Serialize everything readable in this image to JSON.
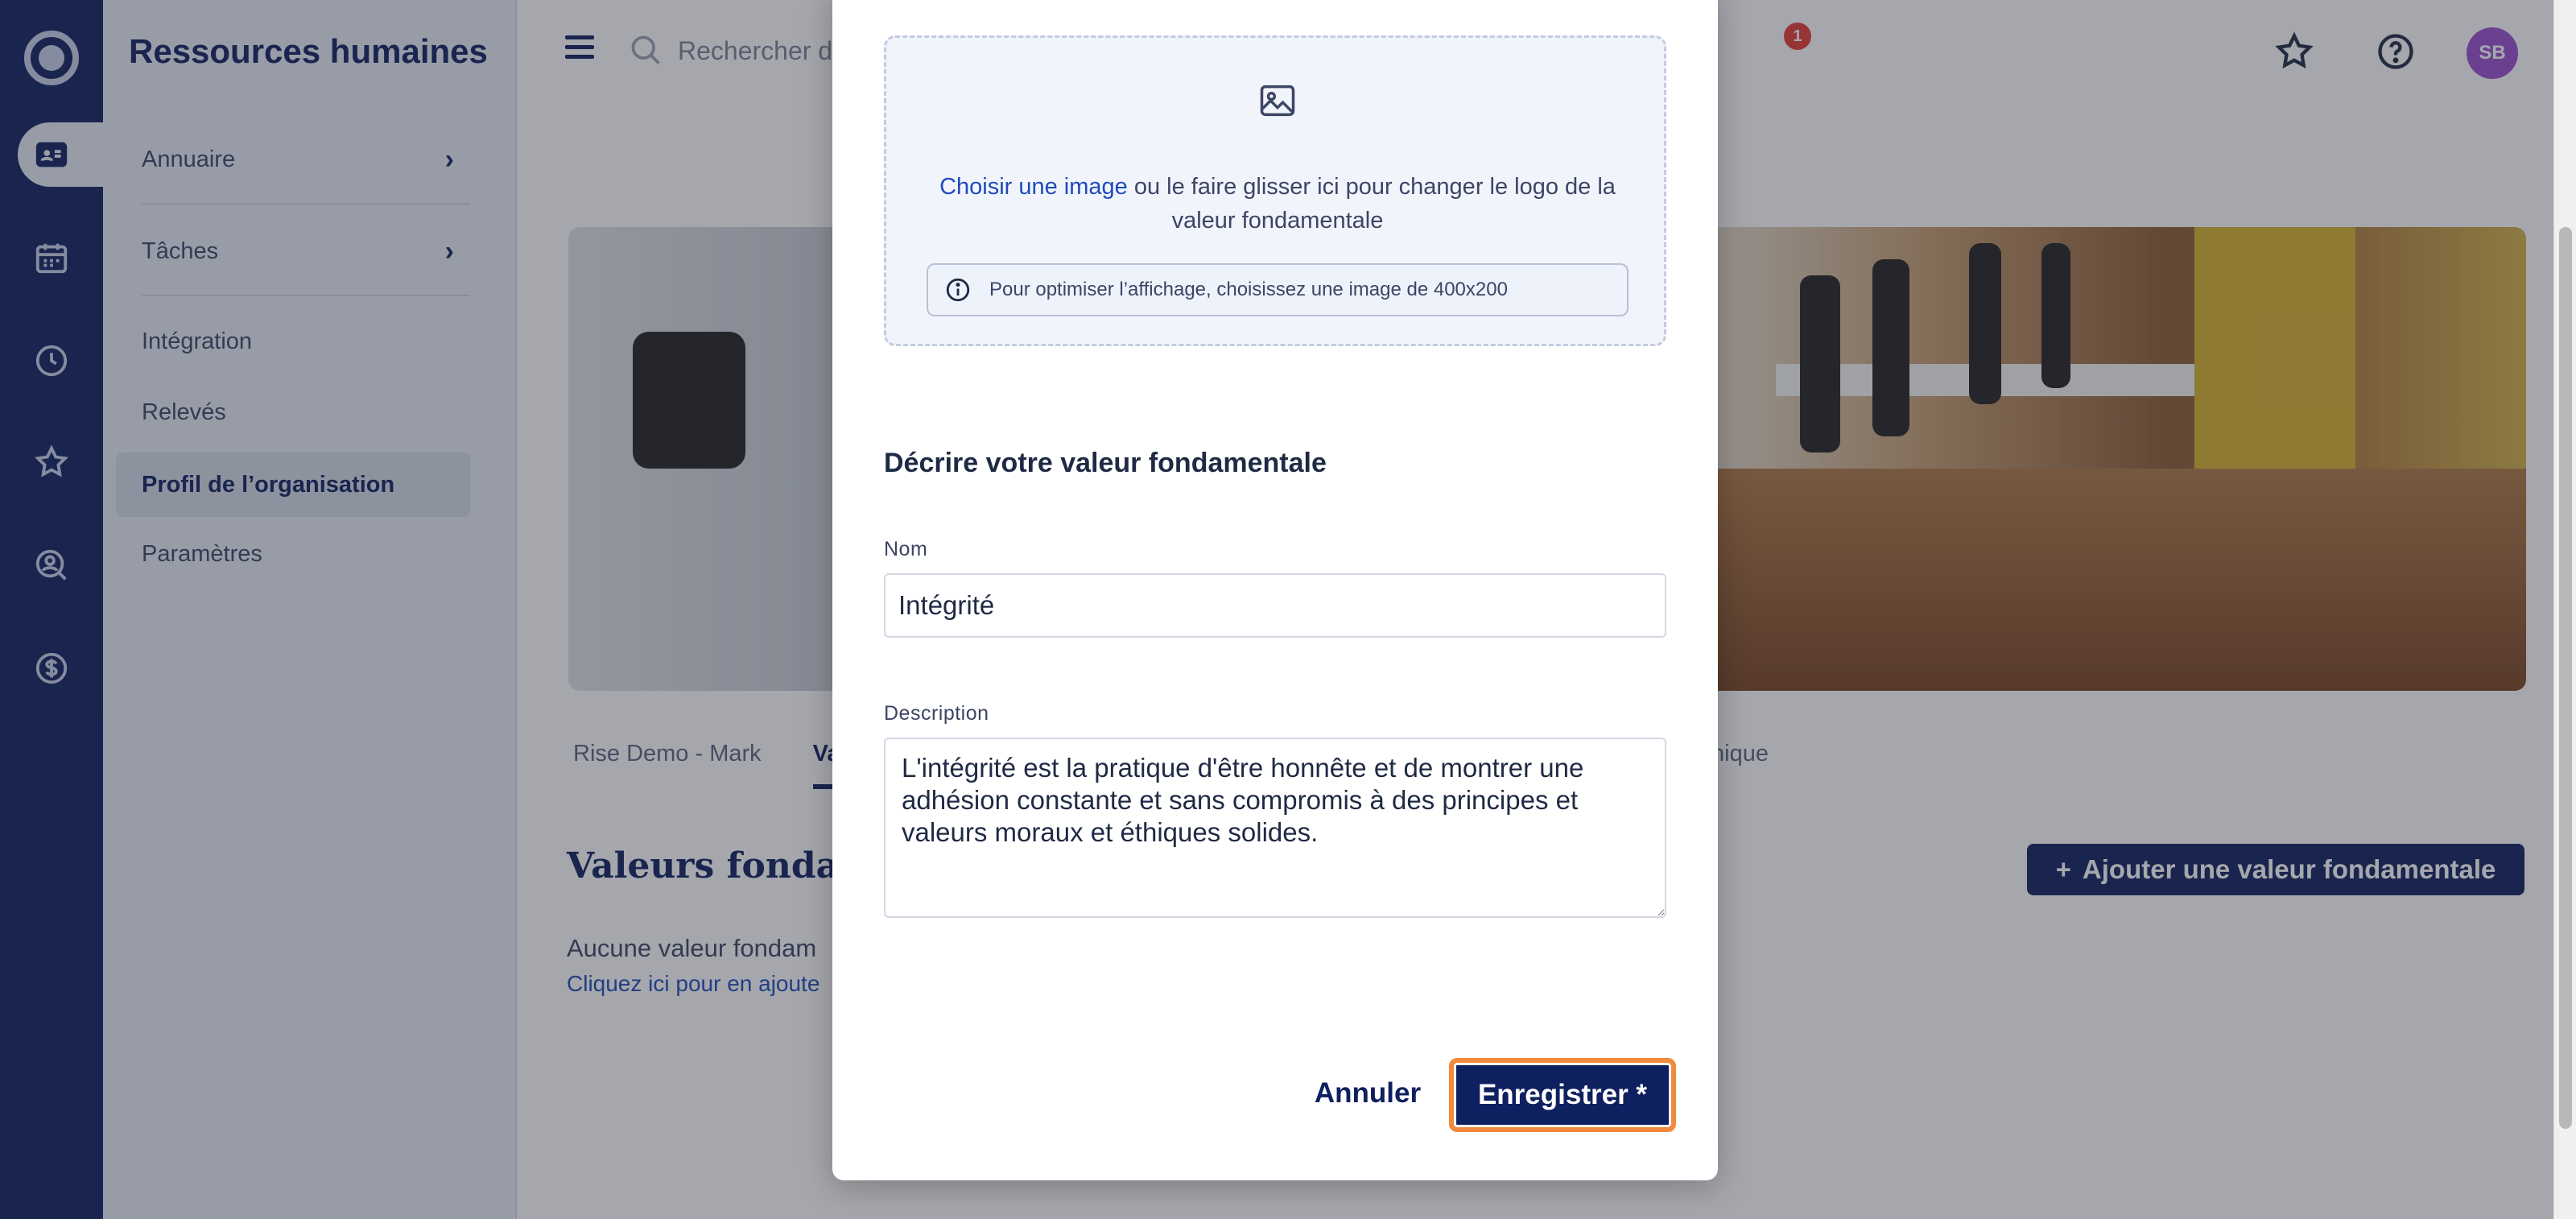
{
  "rail": {
    "icons": [
      "app-logo-icon",
      "employee-card-icon",
      "calendar-icon",
      "clock-icon",
      "star-icon",
      "person-search-icon",
      "dollar-icon"
    ]
  },
  "sidenav": {
    "title": "Ressources humaines",
    "items": [
      {
        "label": "Annuaire",
        "has_chevron": true
      },
      {
        "label": "Tâches",
        "has_chevron": true
      },
      {
        "label": "Intégration"
      },
      {
        "label": "Relevés"
      },
      {
        "label": "Profil de l’organisation",
        "active": true
      },
      {
        "label": "Paramètres"
      }
    ]
  },
  "topbar": {
    "search_placeholder": "Rechercher des employés",
    "notification_count": "1",
    "avatar_initials": "SB"
  },
  "page": {
    "tab_first": "Rise Demo - Mark",
    "tab_active": "Va",
    "tab_right": "nique",
    "section_title": "Valeurs fondam",
    "add_button": "Ajouter une valeur fondamentale",
    "empty_text": "Aucune valeur fondam",
    "empty_link": "Cliquez ici pour en ajoute"
  },
  "modal": {
    "choose_image_link": "Choisir une image",
    "drop_text": "ou le faire glisser ici pour changer le logo de la valeur fondamentale",
    "hint_text": "Pour optimiser l’affichage, choisissez une image de 400x200",
    "form_title": "Décrire votre valeur fondamentale",
    "name_label": "Nom",
    "name_value": "Intégrité",
    "description_label": "Description",
    "description_value": "L'intégrité est la pratique d'être honnête et de montrer une adhésion constante et sans compromis à des principes et valeurs moraux et éthiques solides.",
    "cancel_label": "Annuler",
    "save_label": "Enregistrer *"
  },
  "colors": {
    "brand_navy": "#0f2060",
    "sidenav_bg": "#e9edf7",
    "link_blue": "#1f4bb8",
    "focus_orange": "#f08a3c",
    "avatar_purple": "#9b4fd0"
  }
}
